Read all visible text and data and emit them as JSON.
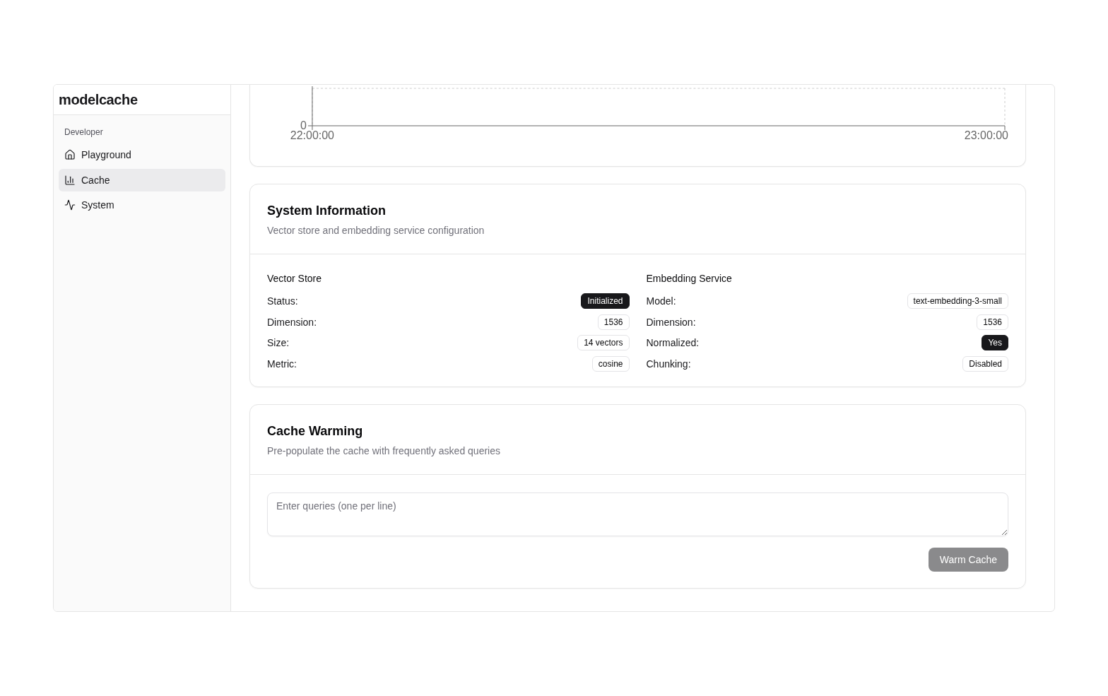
{
  "sidebar": {
    "brand": "modelcache",
    "group_label": "Developer",
    "items": [
      {
        "label": "Playground",
        "selected": false
      },
      {
        "label": "Cache",
        "selected": true
      },
      {
        "label": "System",
        "selected": false
      }
    ]
  },
  "chart_card": {
    "y_axis_labels": [
      "0"
    ],
    "x_axis_labels": [
      "22:00:00",
      "23:00:00"
    ]
  },
  "system_information": {
    "title": "System Information",
    "description": "Vector store and embedding service configuration",
    "sections": [
      {
        "title": "Vector Store",
        "rows": [
          {
            "label": "Status:",
            "value": "Initialized",
            "kind": "solid"
          },
          {
            "label": "Dimension:",
            "value": "1536",
            "kind": "outline"
          },
          {
            "label": "Size:",
            "value": "14 vectors",
            "kind": "outline"
          },
          {
            "label": "Metric:",
            "value": "cosine",
            "kind": "outline"
          }
        ]
      },
      {
        "title": "Embedding Service",
        "rows": [
          {
            "label": "Model:",
            "value": "text-embedding-3-small",
            "kind": "outline"
          },
          {
            "label": "Dimension:",
            "value": "1536",
            "kind": "outline"
          },
          {
            "label": "Normalized:",
            "value": "Yes",
            "kind": "solid"
          },
          {
            "label": "Chunking:",
            "value": "Disabled",
            "kind": "outline"
          }
        ]
      }
    ]
  },
  "cache_warming": {
    "title": "Cache Warming",
    "description": "Pre-populate the cache with frequently asked queries",
    "queries_field": {
      "placeholder": "Enter queries (one per line)"
    },
    "button": {
      "label": "Warm Cache",
      "disabled": true
    }
  }
}
